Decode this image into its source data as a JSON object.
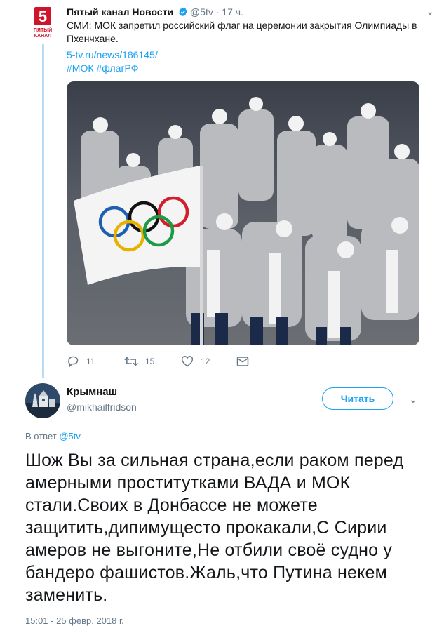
{
  "quoted_tweet": {
    "account_name": "Пятый канал Новости",
    "handle": "@5tv",
    "separator": "·",
    "time": "17 ч.",
    "text": "СМИ: МОК запретил российский флаг на церемонии закрытия Олимпиады в Пхенчхане.",
    "link": "5-tv.ru/news/186145/",
    "hashtags": [
      "#МОК",
      "#флагРФ"
    ],
    "avatar_logo_number": "5",
    "avatar_logo_text": "ПЯТЫЙ\nКАНАЛ",
    "actions": {
      "replies": "11",
      "retweets": "15",
      "likes": "12"
    }
  },
  "reply_tweet": {
    "display_name": "Крымнаш",
    "handle": "@mikhailfridson",
    "follow_label": "Читать",
    "reply_to_prefix": "В ответ",
    "reply_to_handle": "@5tv",
    "text": "Шож Вы за сильная страна,если раком перед амерными проститутками ВАДА и МОК стали.Своих в Донбассе не можете защитить,дипимущесто прокакали,С Сирии амеров не выгоните,Не отбили своё судно у бандеро фашистов.Жаль,что Путина некем заменить.",
    "timestamp": "15:01 - 25 февр. 2018 г."
  },
  "colors": {
    "link_blue": "#1da1f2",
    "secondary_text": "#657786",
    "thread_line": "#b8dcf5",
    "logo_red": "#d0142c"
  },
  "icons": [
    "verified-badge-icon",
    "chevron-down-icon",
    "reply-icon",
    "retweet-icon",
    "like-icon",
    "direct-message-icon"
  ]
}
